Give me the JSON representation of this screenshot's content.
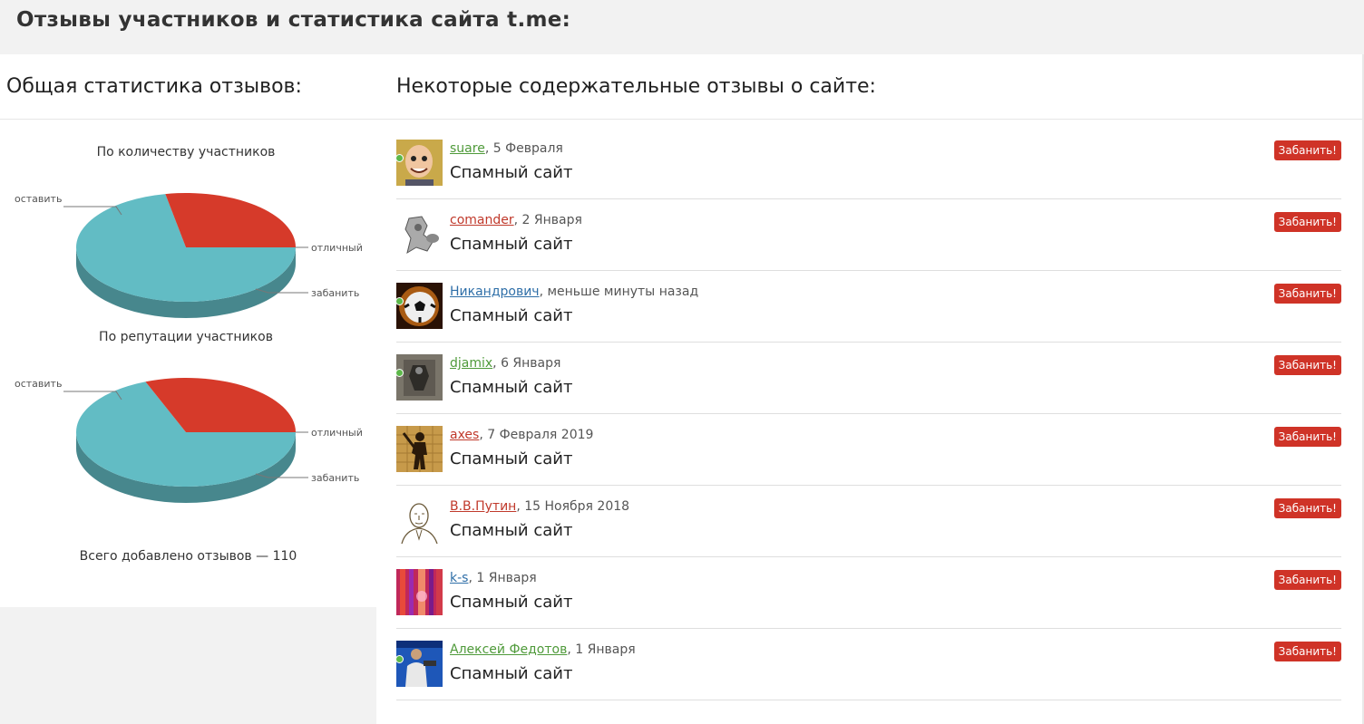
{
  "header": {
    "title": "Отзывы участников и статистика сайта t.me:"
  },
  "stats": {
    "title": "Общая статистика отзывов:",
    "total_text": "Всего добавлено отзывов — 110"
  },
  "chart_data": [
    {
      "type": "pie",
      "title": "По количеству участников",
      "labels": [
        "оставить",
        "отличный",
        "забанить"
      ],
      "values": [
        72,
        0,
        28
      ],
      "colors": [
        "#62bcc4",
        "#d8d8d8",
        "#d63a2a"
      ]
    },
    {
      "type": "pie",
      "title": "По репутации участников",
      "labels": [
        "оставить",
        "отличный",
        "забанить"
      ],
      "values": [
        69,
        0,
        31
      ],
      "colors": [
        "#62bcc4",
        "#d8d8d8",
        "#d63a2a"
      ]
    }
  ],
  "reviews_section": {
    "title": "Некоторые содержательные отзывы о сайте:",
    "ban_label": "Забанить!"
  },
  "reviews": [
    {
      "user": "suare",
      "date": ", 5 Февраля",
      "text": "Спамный сайт",
      "user_color": "green",
      "online": true,
      "avatar": "cartoon-face"
    },
    {
      "user": "comander",
      "date": ", 2 Января",
      "text": "Спамный сайт",
      "user_color": "red",
      "online": false,
      "avatar": "robot-sketch"
    },
    {
      "user": "Никандрович",
      "date": ", меньше минуты назад",
      "text": "Спамный сайт",
      "user_color": "blue",
      "online": true,
      "avatar": "soccer-ball"
    },
    {
      "user": "djamix",
      "date": ", 6 Января",
      "text": "Спамный сайт",
      "user_color": "green",
      "online": true,
      "avatar": "dark-figure"
    },
    {
      "user": "axes",
      "date": ", 7 Февраля 2019",
      "text": "Спамный сайт",
      "user_color": "red",
      "online": false,
      "avatar": "silhouette-miner"
    },
    {
      "user": "В.В.Путин",
      "date": ", 15 Ноября 2018",
      "text": "Спамный сайт",
      "user_color": "red",
      "online": false,
      "avatar": "portrait-sketch"
    },
    {
      "user": "k-s",
      "date": ", 1 Января",
      "text": "Спамный сайт",
      "user_color": "blue",
      "online": false,
      "avatar": "colorful-abstract"
    },
    {
      "user": "Алексей Федотов",
      "date": ", 1 Января",
      "text": "Спамный сайт",
      "user_color": "green",
      "online": true,
      "avatar": "man-blue-bg"
    }
  ]
}
